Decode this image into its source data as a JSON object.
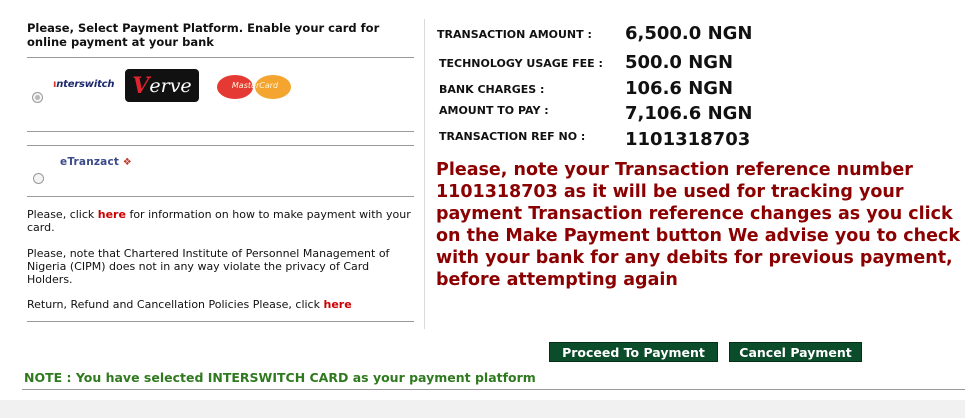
{
  "left_panel": {
    "title": "Please, Select Payment Platform. Enable your card for online payment at your bank",
    "platform_interswitch": {
      "logo_text": "nterswitch",
      "verve_v": "V",
      "verve_rest": "erve",
      "mastercard_text": "MasterCard",
      "selected": true
    },
    "platform_etranzact": {
      "logo_text": "eTranzact",
      "selected": false
    },
    "help_prefix": "Please, click ",
    "help_link": "here",
    "help_suffix": " for information on how to make payment with your card.",
    "privacy_text": "Please, note that Chartered Institute of Personnel Management of Nigeria (CIPM) does not in any way violate the privacy of Card Holders.",
    "policy_prefix": "Return, Refund and Cancellation Policies Please, click ",
    "policy_link": "here"
  },
  "summary": {
    "transaction_amount_label": "TRANSACTION AMOUNT :",
    "transaction_amount_value": "6,500.0 NGN",
    "tech_fee_label": "TECHNOLOGY USAGE FEE :",
    "tech_fee_value": "500.0 NGN",
    "bank_charges_label": "BANK CHARGES :",
    "bank_charges_value": "106.6 NGN",
    "amount_to_pay_label": "AMOUNT TO PAY :",
    "amount_to_pay_value": "7,106.6 NGN",
    "ref_label": "TRANSACTION REF NO :",
    "ref_value": "1101318703"
  },
  "notice": "Please, note your Transaction reference number 1101318703 as it will be used for tracking your payment Transaction reference changes as you click on the Make Payment button We advise you to check with your bank for any debits for previous payment, before attempting again",
  "buttons": {
    "proceed": "Proceed To Payment",
    "cancel": "Cancel Payment"
  },
  "note": "NOTE : You have selected INTERSWITCH CARD as your payment platform",
  "colors": {
    "notice_red": "#8b0000",
    "button_green": "#0b4c2a",
    "note_green": "#2f7a1f",
    "link_red": "#cc0000"
  }
}
